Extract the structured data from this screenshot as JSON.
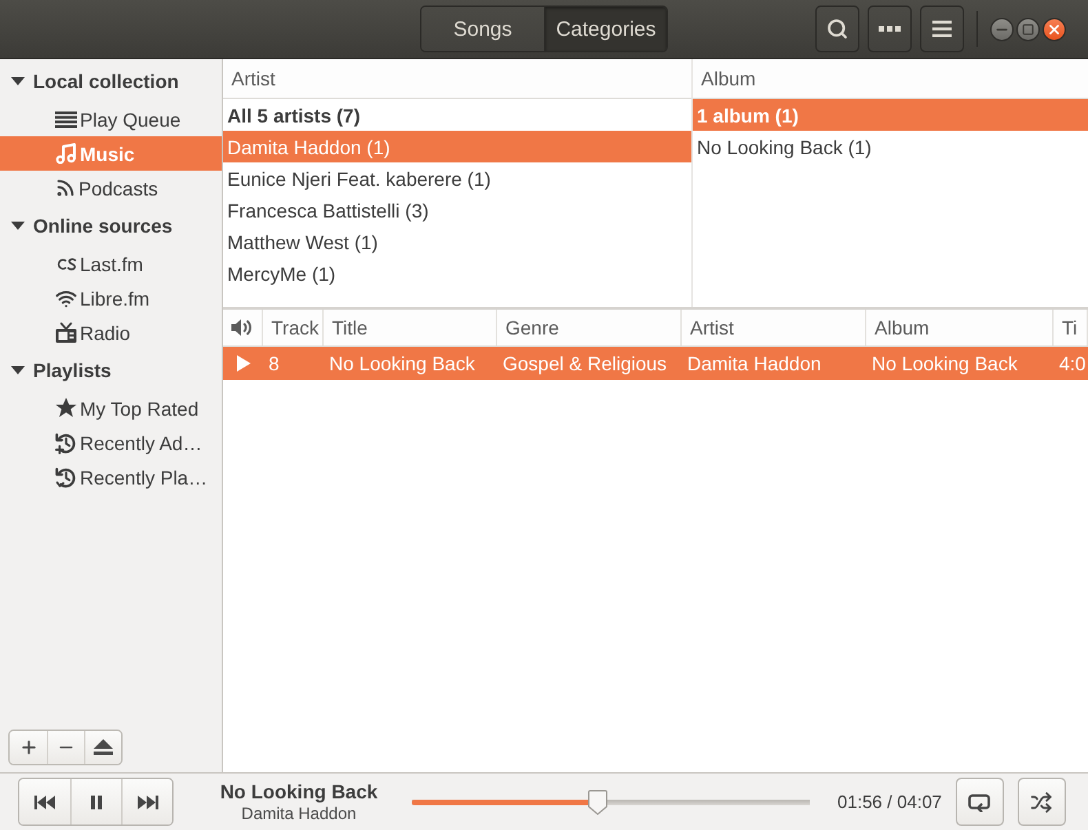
{
  "header": {
    "view_tabs": [
      {
        "label": "Songs",
        "selected": false
      },
      {
        "label": "Categories",
        "selected": true
      }
    ]
  },
  "sidebar": {
    "groups": [
      {
        "label": "Local collection",
        "expanded": true,
        "children": [
          {
            "label": "Play Queue",
            "kind": "queue",
            "selected": false
          },
          {
            "label": "Music",
            "kind": "library",
            "selected": true
          },
          {
            "label": "Podcasts",
            "kind": "feed",
            "selected": false
          }
        ]
      },
      {
        "label": "Online sources",
        "expanded": true,
        "children": [
          {
            "label": "Last.fm",
            "kind": "scrobbler",
            "selected": false
          },
          {
            "label": "Libre.fm",
            "kind": "wireless",
            "selected": false
          },
          {
            "label": "Radio",
            "kind": "radio",
            "selected": false
          }
        ]
      },
      {
        "label": "Playlists",
        "expanded": true,
        "children": [
          {
            "label": "My Top Rated",
            "kind": "rated",
            "selected": false
          },
          {
            "label": "Recently Ad…",
            "kind": "added",
            "selected": false
          },
          {
            "label": "Recently Pla…",
            "kind": "played",
            "selected": false
          }
        ]
      }
    ]
  },
  "browser": {
    "panes": [
      {
        "heading": "Artist",
        "rows": [
          {
            "label": "All 5 artists (7)",
            "kind": "summary",
            "selected": false
          },
          {
            "label": "Damita Haddon (1)",
            "kind": "entry",
            "selected": true
          },
          {
            "label": "Eunice Njeri Feat. kaberere (1)",
            "kind": "entry",
            "selected": false
          },
          {
            "label": "Francesca Battistelli (3)",
            "kind": "entry",
            "selected": false
          },
          {
            "label": "Matthew West (1)",
            "kind": "entry",
            "selected": false
          },
          {
            "label": "MercyMe (1)",
            "kind": "entry",
            "selected": false
          }
        ]
      },
      {
        "heading": "Album",
        "rows": [
          {
            "label": "1 album (1)",
            "kind": "summary",
            "selected": true
          },
          {
            "label": "No Looking Back (1)",
            "kind": "entry",
            "selected": false
          }
        ]
      }
    ]
  },
  "track_list": {
    "columns": [
      "Track",
      "Title",
      "Genre",
      "Artist",
      "Album",
      "Ti"
    ],
    "rows": [
      {
        "selected": true,
        "playing": true,
        "cells": [
          "8",
          "No Looking Back",
          "Gospel & Religious",
          "Damita Haddon",
          "No Looking Back",
          "4:0"
        ]
      }
    ]
  },
  "player": {
    "playing": true,
    "title": "No Looking Back",
    "artist": "Damita Haddon",
    "position": {
      "level": 0.467
    },
    "time": "01:56 / 04:07"
  }
}
